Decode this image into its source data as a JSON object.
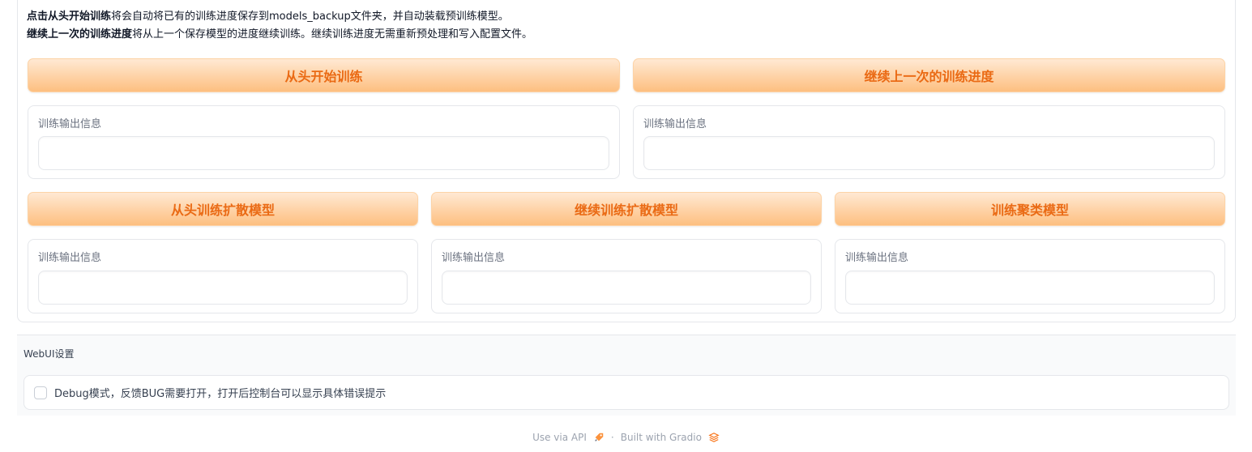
{
  "notes": {
    "line1_bold": "点击从头开始训练",
    "line1_rest": "将会自动将已有的训练进度保存到models_backup文件夹，并自动装载预训练模型。",
    "line2_bold": "继续上一次的训练进度",
    "line2_rest": "将从上一个保存模型的进度继续训练。继续训练进度无需重新预处理和写入配置文件。"
  },
  "row1": {
    "buttons": [
      "从头开始训练",
      "继续上一次的训练进度"
    ],
    "outputs": [
      {
        "label": "训练输出信息",
        "value": ""
      },
      {
        "label": "训练输出信息",
        "value": ""
      }
    ]
  },
  "row2": {
    "buttons": [
      "从头训练扩散模型",
      "继续训练扩散模型",
      "训练聚类模型"
    ],
    "outputs": [
      {
        "label": "训练输出信息",
        "value": ""
      },
      {
        "label": "训练输出信息",
        "value": ""
      },
      {
        "label": "训练输出信息",
        "value": ""
      }
    ]
  },
  "settings": {
    "title": "WebUI设置",
    "debug_label": "Debug模式，反馈BUG需要打开，打开后控制台可以显示具体错误提示",
    "debug_checked": false
  },
  "footer": {
    "api": "Use via API",
    "sep": "·",
    "built": "Built with Gradio",
    "api_icon": "rocket-icon",
    "gradio_icon": "gradio-logo-icon",
    "accent": "#f97316"
  },
  "colors": {
    "button_text": "#ea6a14",
    "button_top": "#ffe9d3",
    "button_bottom": "#fdbf80"
  }
}
